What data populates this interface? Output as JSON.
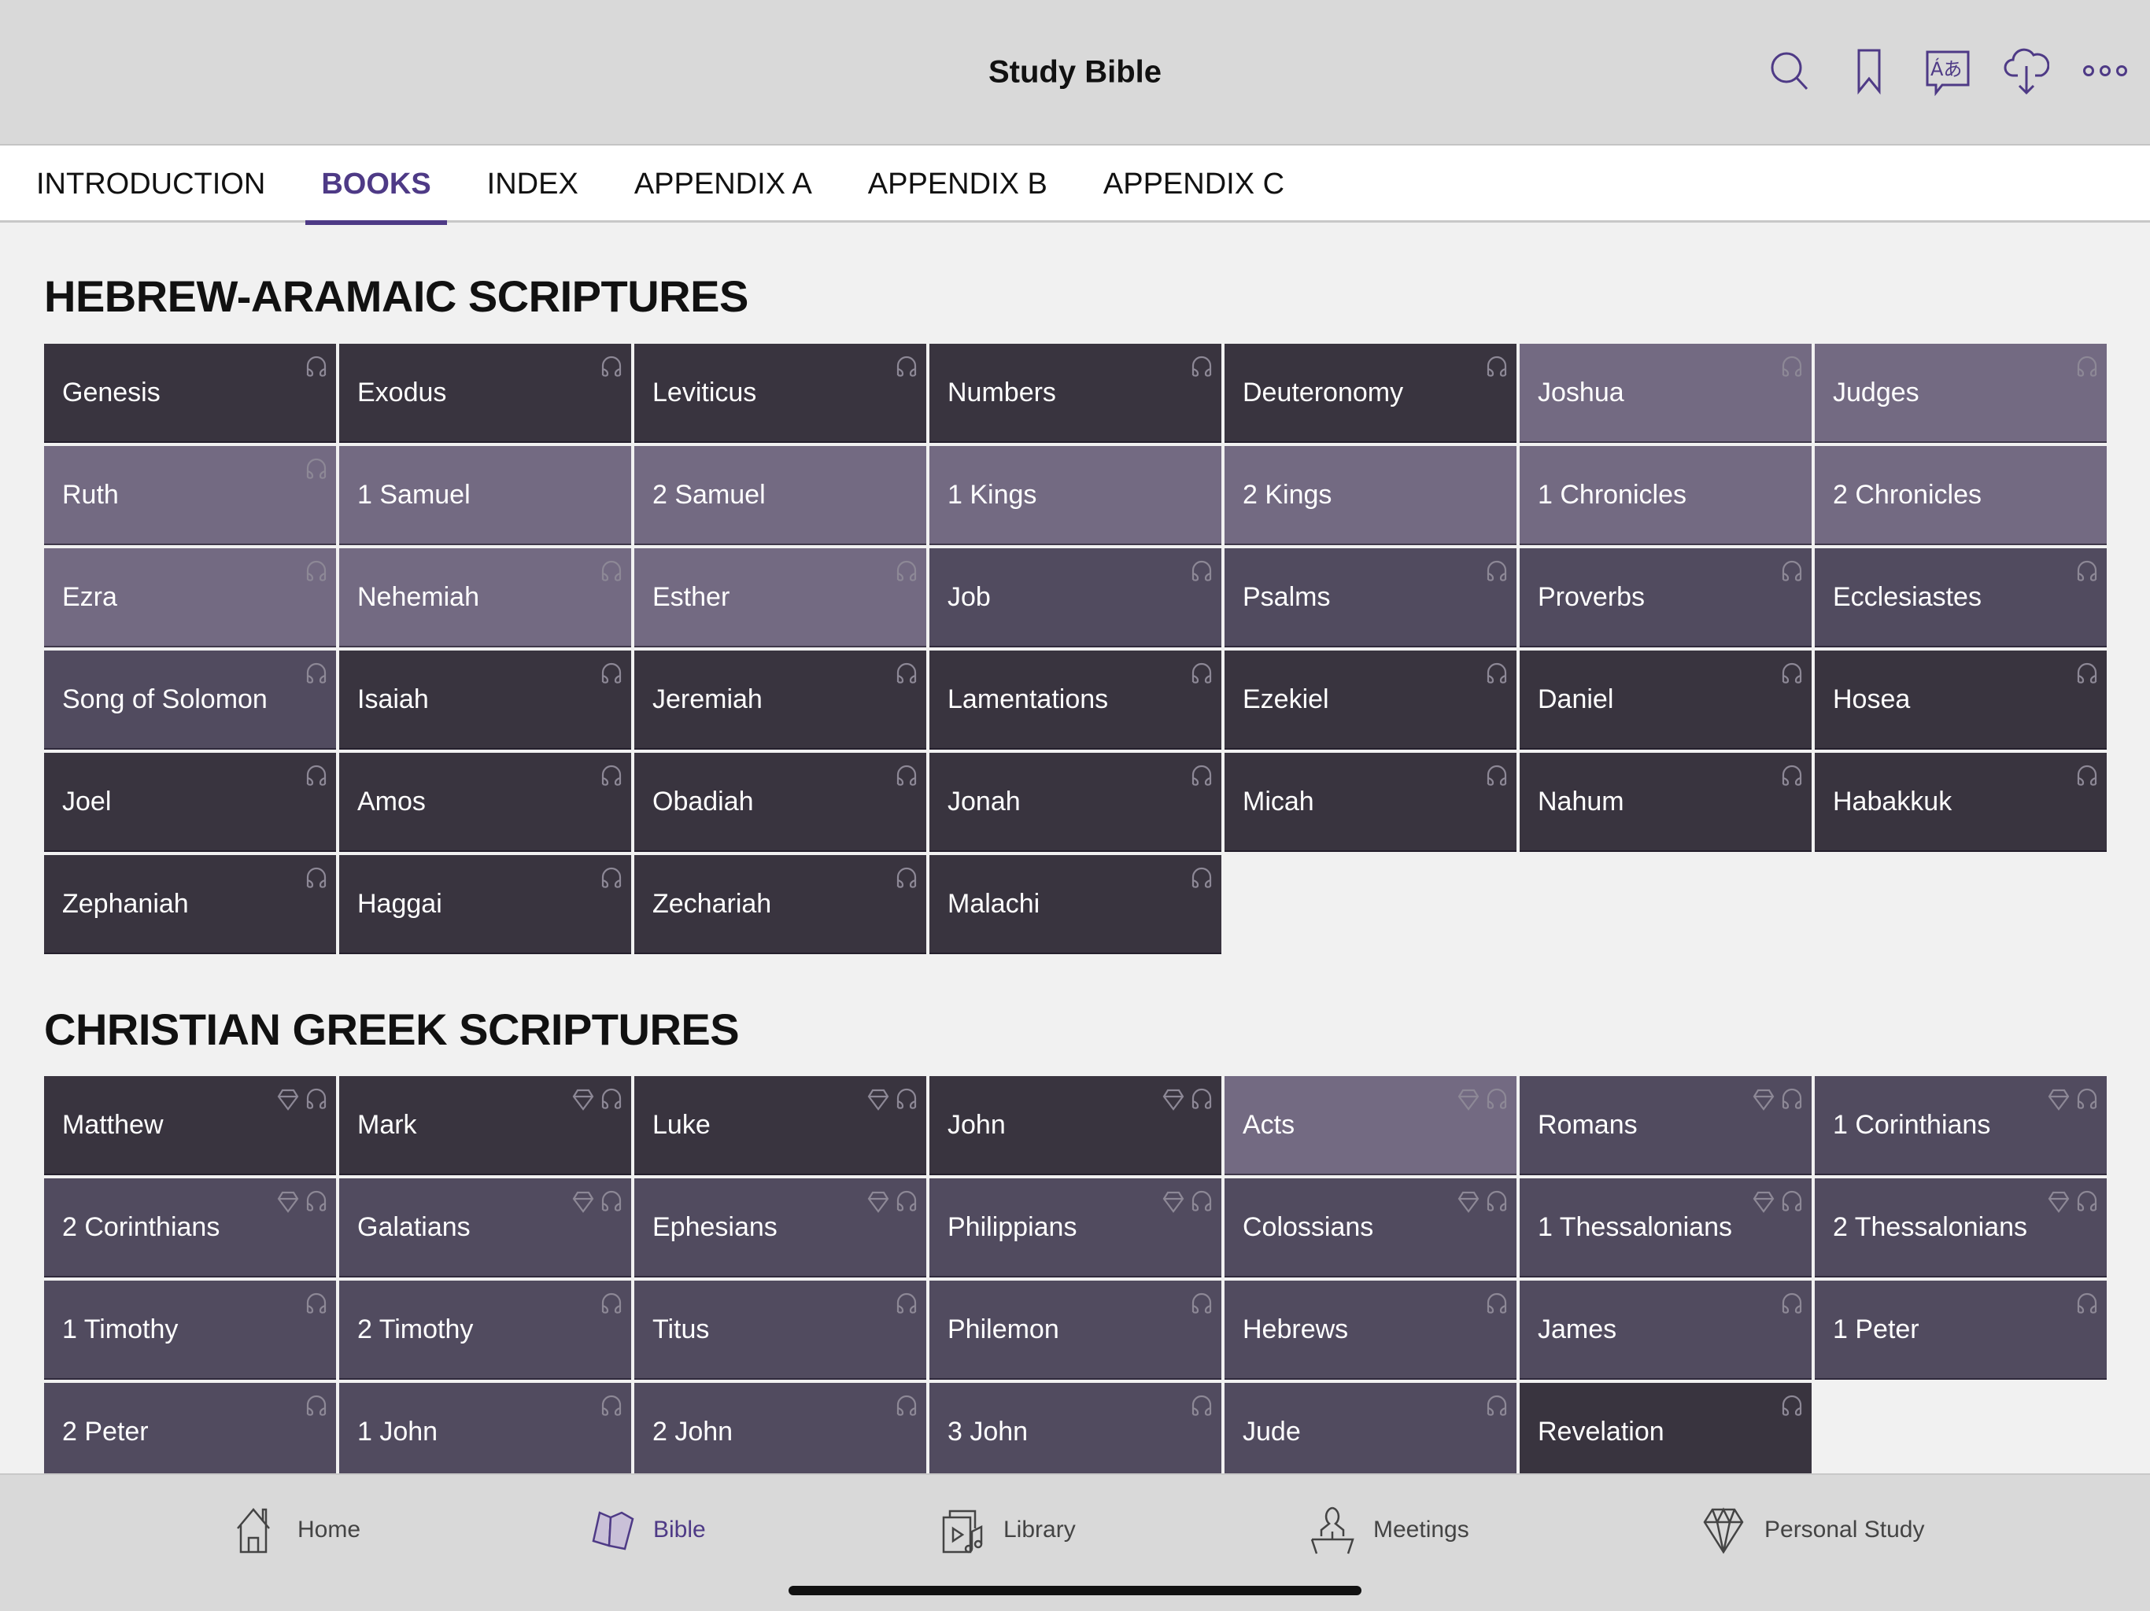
{
  "app": {
    "title": "Study Bible"
  },
  "header_actions": [
    {
      "name": "search-icon",
      "label": "Search"
    },
    {
      "name": "bookmark-icon",
      "label": "Bookmarks"
    },
    {
      "name": "language-icon",
      "label": "Languages"
    },
    {
      "name": "download-cloud-icon",
      "label": "Download"
    },
    {
      "name": "more-icon",
      "label": "More"
    }
  ],
  "tabs": [
    {
      "label": "INTRODUCTION",
      "active": false
    },
    {
      "label": "BOOKS",
      "active": true
    },
    {
      "label": "INDEX",
      "active": false
    },
    {
      "label": "APPENDIX A",
      "active": false
    },
    {
      "label": "APPENDIX B",
      "active": false
    },
    {
      "label": "APPENDIX C",
      "active": false
    }
  ],
  "colors": {
    "accent": "#4e3a86",
    "tile_dark": "#39343f",
    "tile_medium": "#514b5f",
    "tile_light": "#736a82",
    "icon_gray": "#8d8896"
  },
  "sections": [
    {
      "title": "HEBREW-ARAMAIC SCRIPTURES",
      "books": [
        {
          "name": "Genesis",
          "shade": "dark",
          "audio": true,
          "gem": false
        },
        {
          "name": "Exodus",
          "shade": "dark",
          "audio": true,
          "gem": false
        },
        {
          "name": "Leviticus",
          "shade": "dark",
          "audio": true,
          "gem": false
        },
        {
          "name": "Numbers",
          "shade": "dark",
          "audio": true,
          "gem": false
        },
        {
          "name": "Deuteronomy",
          "shade": "dark",
          "audio": true,
          "gem": false
        },
        {
          "name": "Joshua",
          "shade": "light",
          "audio": true,
          "gem": false
        },
        {
          "name": "Judges",
          "shade": "light",
          "audio": true,
          "gem": false
        },
        {
          "name": "Ruth",
          "shade": "light",
          "audio": true,
          "gem": false
        },
        {
          "name": "1 Samuel",
          "shade": "light",
          "audio": false,
          "gem": false
        },
        {
          "name": "2 Samuel",
          "shade": "light",
          "audio": false,
          "gem": false
        },
        {
          "name": "1 Kings",
          "shade": "light",
          "audio": false,
          "gem": false
        },
        {
          "name": "2 Kings",
          "shade": "light",
          "audio": false,
          "gem": false
        },
        {
          "name": "1 Chronicles",
          "shade": "light",
          "audio": false,
          "gem": false
        },
        {
          "name": "2 Chronicles",
          "shade": "light",
          "audio": false,
          "gem": false
        },
        {
          "name": "Ezra",
          "shade": "light",
          "audio": true,
          "gem": false
        },
        {
          "name": "Nehemiah",
          "shade": "light",
          "audio": true,
          "gem": false
        },
        {
          "name": "Esther",
          "shade": "light",
          "audio": true,
          "gem": false
        },
        {
          "name": "Job",
          "shade": "medium",
          "audio": true,
          "gem": false
        },
        {
          "name": "Psalms",
          "shade": "medium",
          "audio": true,
          "gem": false
        },
        {
          "name": "Proverbs",
          "shade": "medium",
          "audio": true,
          "gem": false
        },
        {
          "name": "Ecclesiastes",
          "shade": "medium",
          "audio": true,
          "gem": false
        },
        {
          "name": "Song of Solomon",
          "shade": "medium",
          "audio": true,
          "gem": false
        },
        {
          "name": "Isaiah",
          "shade": "dark",
          "audio": true,
          "gem": false
        },
        {
          "name": "Jeremiah",
          "shade": "dark",
          "audio": true,
          "gem": false
        },
        {
          "name": "Lamentations",
          "shade": "dark",
          "audio": true,
          "gem": false
        },
        {
          "name": "Ezekiel",
          "shade": "dark",
          "audio": true,
          "gem": false
        },
        {
          "name": "Daniel",
          "shade": "dark",
          "audio": true,
          "gem": false
        },
        {
          "name": "Hosea",
          "shade": "dark",
          "audio": true,
          "gem": false
        },
        {
          "name": "Joel",
          "shade": "dark",
          "audio": true,
          "gem": false
        },
        {
          "name": "Amos",
          "shade": "dark",
          "audio": true,
          "gem": false
        },
        {
          "name": "Obadiah",
          "shade": "dark",
          "audio": true,
          "gem": false
        },
        {
          "name": "Jonah",
          "shade": "dark",
          "audio": true,
          "gem": false
        },
        {
          "name": "Micah",
          "shade": "dark",
          "audio": true,
          "gem": false
        },
        {
          "name": "Nahum",
          "shade": "dark",
          "audio": true,
          "gem": false
        },
        {
          "name": "Habakkuk",
          "shade": "dark",
          "audio": true,
          "gem": false
        },
        {
          "name": "Zephaniah",
          "shade": "dark",
          "audio": true,
          "gem": false
        },
        {
          "name": "Haggai",
          "shade": "dark",
          "audio": true,
          "gem": false
        },
        {
          "name": "Zechariah",
          "shade": "dark",
          "audio": true,
          "gem": false
        },
        {
          "name": "Malachi",
          "shade": "dark",
          "audio": true,
          "gem": false
        }
      ]
    },
    {
      "title": "CHRISTIAN GREEK SCRIPTURES",
      "books": [
        {
          "name": "Matthew",
          "shade": "dark",
          "audio": true,
          "gem": true
        },
        {
          "name": "Mark",
          "shade": "dark",
          "audio": true,
          "gem": true
        },
        {
          "name": "Luke",
          "shade": "dark",
          "audio": true,
          "gem": true
        },
        {
          "name": "John",
          "shade": "dark",
          "audio": true,
          "gem": true
        },
        {
          "name": "Acts",
          "shade": "light",
          "audio": true,
          "gem": true
        },
        {
          "name": "Romans",
          "shade": "medium",
          "audio": true,
          "gem": true
        },
        {
          "name": "1 Corinthians",
          "shade": "medium",
          "audio": true,
          "gem": true
        },
        {
          "name": "2 Corinthians",
          "shade": "medium",
          "audio": true,
          "gem": true
        },
        {
          "name": "Galatians",
          "shade": "medium",
          "audio": true,
          "gem": true
        },
        {
          "name": "Ephesians",
          "shade": "medium",
          "audio": true,
          "gem": true
        },
        {
          "name": "Philippians",
          "shade": "medium",
          "audio": true,
          "gem": true
        },
        {
          "name": "Colossians",
          "shade": "medium",
          "audio": true,
          "gem": true
        },
        {
          "name": "1 Thessalonians",
          "shade": "medium",
          "audio": true,
          "gem": true
        },
        {
          "name": "2 Thessalonians",
          "shade": "medium",
          "audio": true,
          "gem": true
        },
        {
          "name": "1 Timothy",
          "shade": "medium",
          "audio": true,
          "gem": false
        },
        {
          "name": "2 Timothy",
          "shade": "medium",
          "audio": true,
          "gem": false
        },
        {
          "name": "Titus",
          "shade": "medium",
          "audio": true,
          "gem": false
        },
        {
          "name": "Philemon",
          "shade": "medium",
          "audio": true,
          "gem": false
        },
        {
          "name": "Hebrews",
          "shade": "medium",
          "audio": true,
          "gem": false
        },
        {
          "name": "James",
          "shade": "medium",
          "audio": true,
          "gem": false
        },
        {
          "name": "1 Peter",
          "shade": "medium",
          "audio": true,
          "gem": false
        },
        {
          "name": "2 Peter",
          "shade": "medium",
          "audio": true,
          "gem": false
        },
        {
          "name": "1 John",
          "shade": "medium",
          "audio": true,
          "gem": false
        },
        {
          "name": "2 John",
          "shade": "medium",
          "audio": true,
          "gem": false
        },
        {
          "name": "3 John",
          "shade": "medium",
          "audio": true,
          "gem": false
        },
        {
          "name": "Jude",
          "shade": "medium",
          "audio": true,
          "gem": false
        },
        {
          "name": "Revelation",
          "shade": "dark",
          "audio": true,
          "gem": false
        }
      ]
    }
  ],
  "bottom_nav": [
    {
      "label": "Home",
      "icon": "home-icon",
      "active": false
    },
    {
      "label": "Bible",
      "icon": "bible-icon",
      "active": true
    },
    {
      "label": "Library",
      "icon": "library-icon",
      "active": false
    },
    {
      "label": "Meetings",
      "icon": "meetings-icon",
      "active": false
    },
    {
      "label": "Personal Study",
      "icon": "personal-study-icon",
      "active": false
    }
  ]
}
